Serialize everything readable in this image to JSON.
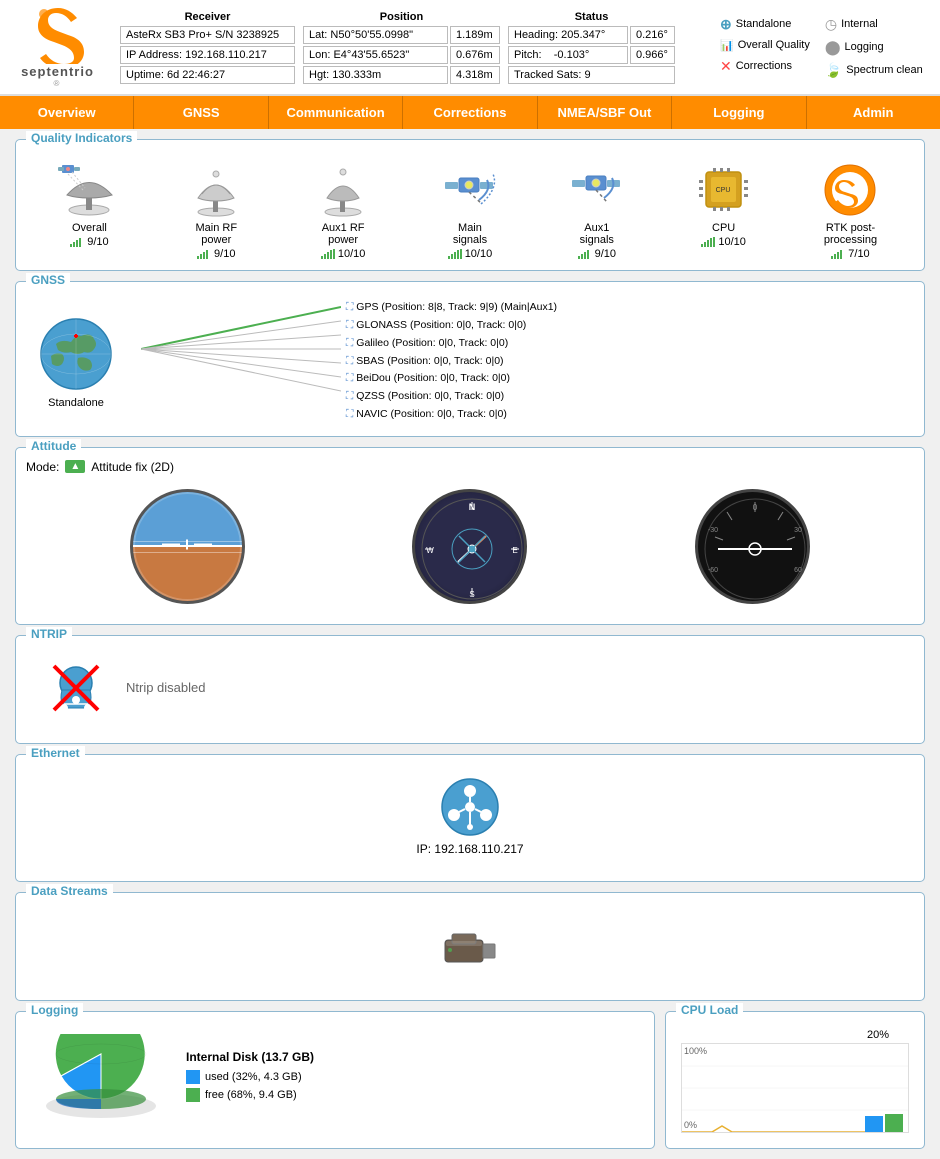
{
  "header": {
    "logo_text": "septentrio",
    "receiver": {
      "title": "Receiver",
      "rows": [
        "AsteRx SB3 Pro+ S/N 3238925",
        "IP Address: 192.168.110.217",
        "Uptime: 6d 22:46:27"
      ]
    },
    "position": {
      "title": "Position",
      "rows": [
        {
          "label": "Lat: N50°50'55.0998\"",
          "value": "1.189m"
        },
        {
          "label": "Lon: E4°43'55.6523\"",
          "value": "0.676m"
        },
        {
          "label": "Hgt: 130.333m",
          "value": "4.318m"
        }
      ]
    },
    "status": {
      "title": "Status",
      "rows": [
        {
          "label": "Heading: 205.347°",
          "value": "0.216°"
        },
        {
          "label": "Pitch: -0.103°",
          "value": "0.966°"
        },
        {
          "label": "Tracked Sats: 9",
          "value": ""
        }
      ]
    },
    "legend": {
      "items": [
        {
          "icon": "plus-circle",
          "label": "Standalone",
          "color": "#4a9fc0"
        },
        {
          "icon": "bar-chart",
          "label": "Overall Quality",
          "color": "#ff8c00"
        },
        {
          "icon": "x-mark",
          "label": "Corrections",
          "color": "#ff4444"
        },
        {
          "icon": "circle",
          "label": "Internal",
          "color": "#888"
        },
        {
          "icon": "circle-gray",
          "label": "Logging",
          "color": "#888"
        },
        {
          "icon": "leaf",
          "label": "Spectrum clean",
          "color": "#4caf50"
        }
      ]
    }
  },
  "navbar": {
    "items": [
      "Overview",
      "GNSS",
      "Communication",
      "Corrections",
      "NMEA/SBF Out",
      "Logging",
      "Admin"
    ]
  },
  "quality_indicators": {
    "title": "Quality Indicators",
    "items": [
      {
        "label": "Overall",
        "score": "9/10",
        "icon": "overall"
      },
      {
        "label": "Main RF power",
        "score": "9/10",
        "icon": "main-rf"
      },
      {
        "label": "Aux1 RF power",
        "score": "10/10",
        "icon": "aux1-rf"
      },
      {
        "label": "Main signals",
        "score": "10/10",
        "icon": "main-signals"
      },
      {
        "label": "Aux1 signals",
        "score": "9/10",
        "icon": "aux1-signals"
      },
      {
        "label": "CPU",
        "score": "10/10",
        "icon": "cpu"
      },
      {
        "label": "RTK post-processing",
        "score": "7/10",
        "icon": "rtk"
      }
    ]
  },
  "gnss": {
    "title": "GNSS",
    "mode": "Standalone",
    "systems": [
      "GPS (Position: 8|8, Track: 9|9) (Main|Aux1)",
      "GLONASS (Position: 0|0, Track: 0|0)",
      "Galileo (Position: 0|0, Track: 0|0)",
      "SBAS (Position: 0|0, Track: 0|0)",
      "BeiDou (Position: 0|0, Track: 0|0)",
      "QZSS (Position: 0|0, Track: 0|0)",
      "NAVIC (Position: 0|0, Track: 0|0)"
    ]
  },
  "attitude": {
    "title": "Attitude",
    "mode": "Attitude fix (2D)"
  },
  "ntrip": {
    "title": "NTRIP",
    "status": "Ntrip disabled"
  },
  "ethernet": {
    "title": "Ethernet",
    "ip": "IP: 192.168.110.217"
  },
  "data_streams": {
    "title": "Data Streams"
  },
  "logging": {
    "title": "Logging",
    "disk_title": "Internal Disk (13.7 GB)",
    "used_label": "used (32%, 4.3 GB)",
    "free_label": "free (68%, 9.4 GB)",
    "used_percent": 32,
    "free_percent": 68,
    "used_color": "#2196f3",
    "free_color": "#4caf50"
  },
  "cpu_load": {
    "title": "CPU Load",
    "percent": "20%",
    "y_labels": [
      "100%",
      "0%"
    ]
  }
}
